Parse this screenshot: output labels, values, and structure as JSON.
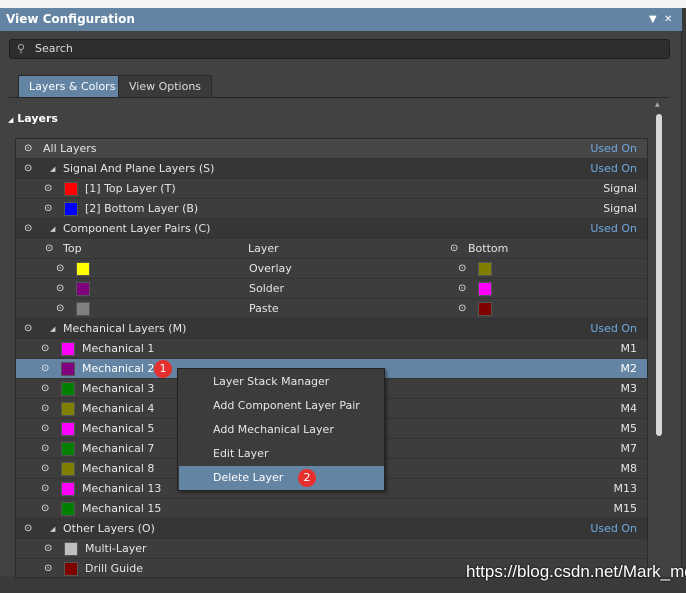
{
  "window": {
    "title": "View Configuration",
    "menu_icon": "▼",
    "close_icon": "✕"
  },
  "search": {
    "placeholder": "Search"
  },
  "tabs": [
    {
      "label": "Layers & Colors",
      "active": true
    },
    {
      "label": "View Options",
      "active": false
    }
  ],
  "section": {
    "label": "Layers"
  },
  "colors": {
    "accent": "#6384a3",
    "used_on": "#6fa7de",
    "badge": "#e63030"
  },
  "rows": [
    {
      "kind": "all",
      "label": "All Layers",
      "right": "Used On",
      "blue": true
    },
    {
      "kind": "group",
      "label": "Signal And Plane Layers (S)",
      "right": "Used On",
      "blue": true
    },
    {
      "kind": "item",
      "label": "[1] Top Layer (T)",
      "color": "#ff0000",
      "right": "Signal"
    },
    {
      "kind": "item",
      "label": "[2] Bottom Layer (B)",
      "color": "#0000ff",
      "right": "Signal"
    },
    {
      "kind": "group",
      "label": "Component Layer Pairs (C)",
      "right": "Used On",
      "blue": true
    },
    {
      "kind": "pairhead",
      "top": "Top",
      "layer": "Layer",
      "bottom": "Bottom"
    },
    {
      "kind": "pair",
      "layer": "Overlay",
      "top_color": "#ffff00",
      "bottom_color": "#808000"
    },
    {
      "kind": "pair",
      "layer": "Solder",
      "top_color": "#800080",
      "bottom_color": "#ff00ff"
    },
    {
      "kind": "pair",
      "layer": "Paste",
      "top_color": "#808080",
      "bottom_color": "#800000"
    },
    {
      "kind": "group",
      "label": "Mechanical Layers (M)",
      "right": "Used On",
      "blue": true
    },
    {
      "kind": "mech",
      "label": "Mechanical 1",
      "color": "#ff00ff",
      "right": "M1"
    },
    {
      "kind": "mech",
      "label": "Mechanical 2",
      "color": "#800080",
      "right": "M2",
      "selected": true,
      "badge": "1"
    },
    {
      "kind": "mech",
      "label": "Mechanical 3",
      "color": "#008000",
      "right": "M3"
    },
    {
      "kind": "mech",
      "label": "Mechanical 4",
      "color": "#808000",
      "right": "M4"
    },
    {
      "kind": "mech",
      "label": "Mechanical 5",
      "color": "#ff00ff",
      "right": "M5"
    },
    {
      "kind": "mech",
      "label": "Mechanical 7",
      "color": "#008000",
      "right": "M7"
    },
    {
      "kind": "mech",
      "label": "Mechanical 8",
      "color": "#808000",
      "right": "M8"
    },
    {
      "kind": "mech",
      "label": "Mechanical 13",
      "color": "#ff00ff",
      "right": "M13"
    },
    {
      "kind": "mech",
      "label": "Mechanical 15",
      "color": "#008000",
      "right": "M15"
    },
    {
      "kind": "group",
      "label": "Other Layers (O)",
      "right": "Used On",
      "blue": true
    },
    {
      "kind": "item",
      "label": "Multi-Layer",
      "color": "#c0c0c0",
      "right": ""
    },
    {
      "kind": "item",
      "label": "Drill Guide",
      "color": "#800000",
      "right": ""
    }
  ],
  "context_menu": {
    "items": [
      {
        "label": "Layer Stack Manager"
      },
      {
        "label": "Add Component Layer Pair"
      },
      {
        "label": "Add Mechanical Layer"
      },
      {
        "label": "Edit Layer"
      },
      {
        "label": "Delete Layer",
        "highlighted": true,
        "badge": "2"
      }
    ]
  },
  "watermark": "https://blog.csdn.net/Mark_md"
}
